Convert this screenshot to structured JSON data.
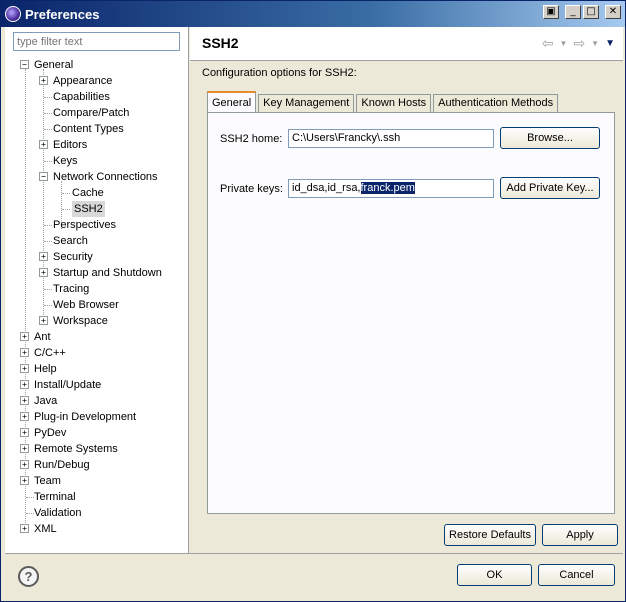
{
  "window": {
    "title": "Preferences",
    "icon": "eclipse-icon"
  },
  "filter": {
    "placeholder": "type filter text"
  },
  "tree": {
    "general": "General",
    "appearance": "Appearance",
    "capabilities": "Capabilities",
    "compare_patch": "Compare/Patch",
    "content_types": "Content Types",
    "editors": "Editors",
    "keys": "Keys",
    "network_connections": "Network Connections",
    "cache": "Cache",
    "ssh2": "SSH2",
    "perspectives": "Perspectives",
    "search": "Search",
    "security": "Security",
    "startup_shutdown": "Startup and Shutdown",
    "tracing": "Tracing",
    "web_browser": "Web Browser",
    "workspace": "Workspace",
    "ant": "Ant",
    "cpp": "C/C++",
    "help": "Help",
    "install_update": "Install/Update",
    "java": "Java",
    "plugin_dev": "Plug-in Development",
    "pydev": "PyDev",
    "remote_systems": "Remote Systems",
    "run_debug": "Run/Debug",
    "team": "Team",
    "terminal": "Terminal",
    "validation": "Validation",
    "xml": "XML"
  },
  "page": {
    "title": "SSH2",
    "description": "Configuration options for SSH2:"
  },
  "tabs": {
    "general": "General",
    "key_management": "Key Management",
    "known_hosts": "Known Hosts",
    "auth_methods": "Authentication Methods"
  },
  "form": {
    "ssh_home_label": "SSH2 home:",
    "ssh_home_value": "C:\\Users\\Francky\\.ssh",
    "browse_label": "Browse...",
    "private_keys_label": "Private keys:",
    "private_keys_prefix": "id_dsa,id_rsa,",
    "private_keys_selected": "franck.pem",
    "add_private_key_label": "Add Private Key..."
  },
  "buttons": {
    "restore_defaults": "Restore Defaults",
    "apply": "Apply",
    "ok": "OK",
    "cancel": "Cancel"
  },
  "colors": {
    "selection": "#0a246a",
    "tab_accent": "#e68b2c"
  }
}
